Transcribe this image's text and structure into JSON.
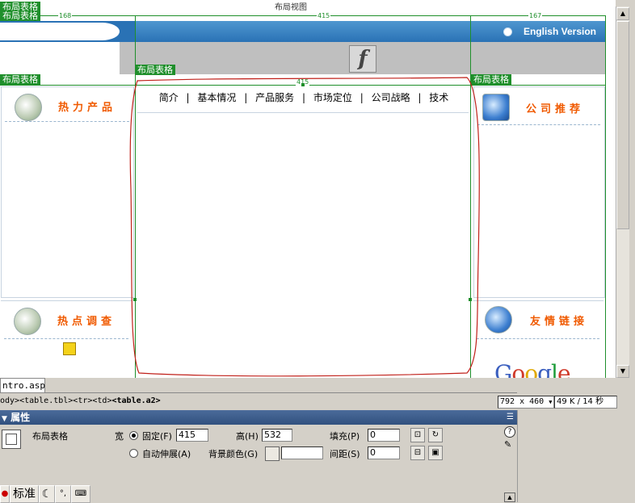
{
  "canvas": {
    "view_title": "布局视图",
    "layout_tag": "布局表格",
    "ruler": {
      "left": "168",
      "middle": "415",
      "right": "167",
      "center_cell": "415"
    },
    "header": {
      "english_label": "English Version"
    },
    "left_panel": {
      "top_title": "热力产品",
      "bottom_title": "热点调查"
    },
    "right_panel": {
      "top_title": "公司推荐",
      "bottom_title": "友情链接"
    },
    "nav_items": [
      "简介",
      "基本情况",
      "产品服务",
      "市场定位",
      "公司战略",
      "技术"
    ],
    "nav_separator": "|",
    "google_logo": {
      "g1": "G",
      "o1": "o",
      "o2": "o",
      "g2": "g",
      "l": "l",
      "e": "e"
    }
  },
  "document": {
    "tab_label": "ntro.asp",
    "tag_path_prefix": "ody><table.tbl><tr><td>",
    "tag_path_current": "<table.a2>",
    "window_size": "792 x 460",
    "file_stats": "49 K / 14 秒"
  },
  "properties": {
    "header": "属性",
    "element_type": "布局表格",
    "width_label": "宽",
    "fixed_label": "固定(F)",
    "width_value": "415",
    "auto_label": "自动伸展(A)",
    "height_label": "高(H)",
    "height_value": "532",
    "bgcolor_label": "背景颜色(G)",
    "padding_label": "填充(P)",
    "padding_value": "0",
    "spacing_label": "间距(S)",
    "spacing_value": "0"
  },
  "bottom_toolbar": {
    "standard_label": "标准"
  },
  "colors": {
    "accent_orange": "#f05a00",
    "layout_green": "#1f8f2b",
    "header_blue": "#2a72b5"
  }
}
